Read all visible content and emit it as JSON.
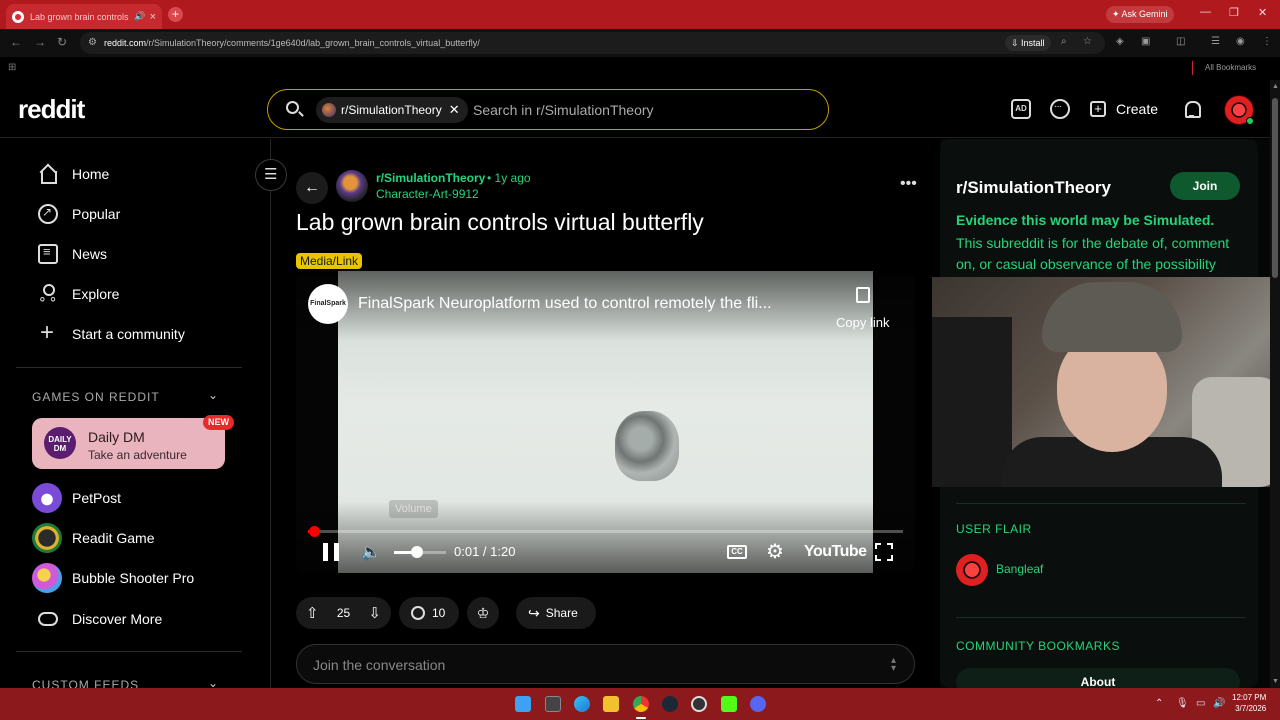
{
  "browser": {
    "tab_title": "Lab grown brain controls vi",
    "ask_gemini": "Ask Gemini",
    "url_host": "reddit.com",
    "url_path": "/r/SimulationTheory/comments/1ge640d/lab_grown_brain_controls_virtual_butterfly/",
    "install_label": "Install",
    "all_bookmarks": "All Bookmarks"
  },
  "header": {
    "logo": "reddit",
    "search_chip": "r/SimulationTheory",
    "search_placeholder": "Search in r/SimulationTheory",
    "create_label": "Create"
  },
  "sidebar": {
    "nav": [
      {
        "label": "Home",
        "icon": "home-icon"
      },
      {
        "label": "Popular",
        "icon": "popular-icon"
      },
      {
        "label": "News",
        "icon": "news-icon"
      },
      {
        "label": "Explore",
        "icon": "explore-icon"
      },
      {
        "label": "Start a community",
        "icon": "plus-icon"
      }
    ],
    "games_section": "GAMES ON REDDIT",
    "featured_game": {
      "avatar_text": "DAILY DM",
      "title": "Daily DM",
      "subtitle": "Take an adventure",
      "badge": "NEW"
    },
    "games": [
      {
        "label": "PetPost"
      },
      {
        "label": "Readit Game"
      },
      {
        "label": "Bubble Shooter Pro"
      },
      {
        "label": "Discover More"
      }
    ],
    "custom_feeds_section": "CUSTOM FEEDS"
  },
  "post": {
    "subreddit": "r/SimulationTheory",
    "time": "• 1y ago",
    "author": "Character-Art-9912",
    "title": "Lab grown brain controls virtual butterfly",
    "flair": "Media/Link",
    "video": {
      "channel_avatar_text": "FinalSpark",
      "title": "FinalSpark Neuroplatform used to control remotely the fli...",
      "copy_link": "Copy link",
      "volume_tooltip": "Volume",
      "time_display": "0:01 / 1:20",
      "cc_label": "CC",
      "youtube_label": "YouTube",
      "progress": 0.0125,
      "volume": 0.4
    },
    "votes": "25",
    "comments": "10",
    "share_label": "Share",
    "comment_placeholder": "Join the conversation"
  },
  "right_sidebar": {
    "name": "r/SimulationTheory",
    "join_label": "Join",
    "tagline": "Evidence this world may be Simulated.",
    "description": "This subreddit is for the debate of, comment on, or casual observance of the possibility",
    "user_flair_section": "USER FLAIR",
    "flair_name": "Bangleaf",
    "bookmarks_section": "COMMUNITY BOOKMARKS",
    "about_label": "About"
  },
  "taskbar": {
    "time": "12:07 PM",
    "date": "3/7/2026"
  },
  "colors": {
    "accent_green": "#25d47a",
    "flair_yellow": "#e9c400",
    "browser_red": "#b01a1f",
    "taskbar_red": "#8c1a1c"
  }
}
